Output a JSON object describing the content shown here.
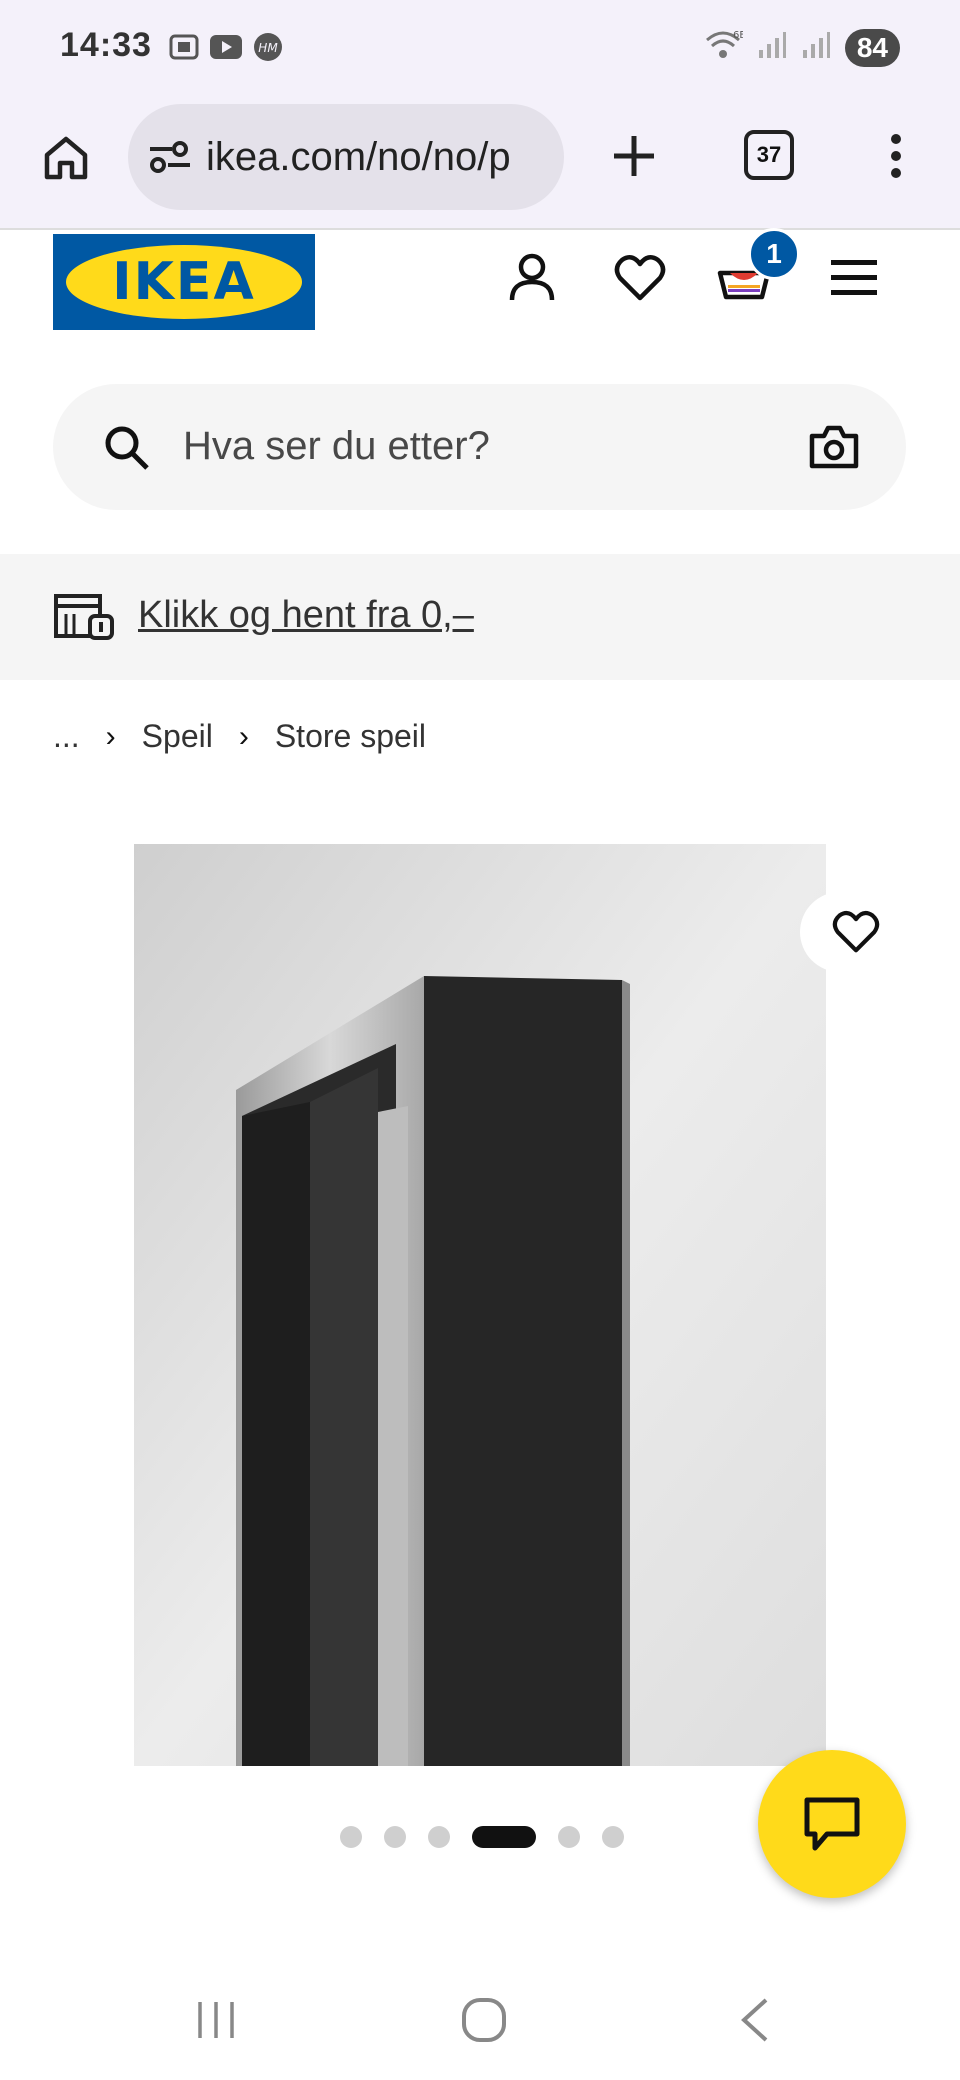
{
  "status_bar": {
    "time": "14:33",
    "battery": "84",
    "left_icons": [
      "screenshot-icon",
      "youtube-icon",
      "hm-icon"
    ],
    "right_icons": [
      "wifi-6e-icon",
      "signal-icon",
      "signal-icon"
    ]
  },
  "browser": {
    "url": "ikea.com/no/no/p",
    "tab_count": "37"
  },
  "header": {
    "logo_text": "IKEA",
    "cart_count": "1",
    "icons": [
      "account-icon",
      "heart-icon",
      "cart-icon",
      "hamburger-menu-icon"
    ]
  },
  "search": {
    "placeholder": "Hva ser du etter?"
  },
  "collect": {
    "label": "Klikk og hent fra 0,–"
  },
  "breadcrumb": {
    "ellipsis": "...",
    "items": [
      "Speil",
      "Store speil"
    ]
  },
  "carousel": {
    "total_dots": 6,
    "active_index": 3
  },
  "colors": {
    "ikea_blue": "#0058a3",
    "ikea_yellow": "#ffda1a",
    "browser_bg": "#f4f1fa"
  }
}
